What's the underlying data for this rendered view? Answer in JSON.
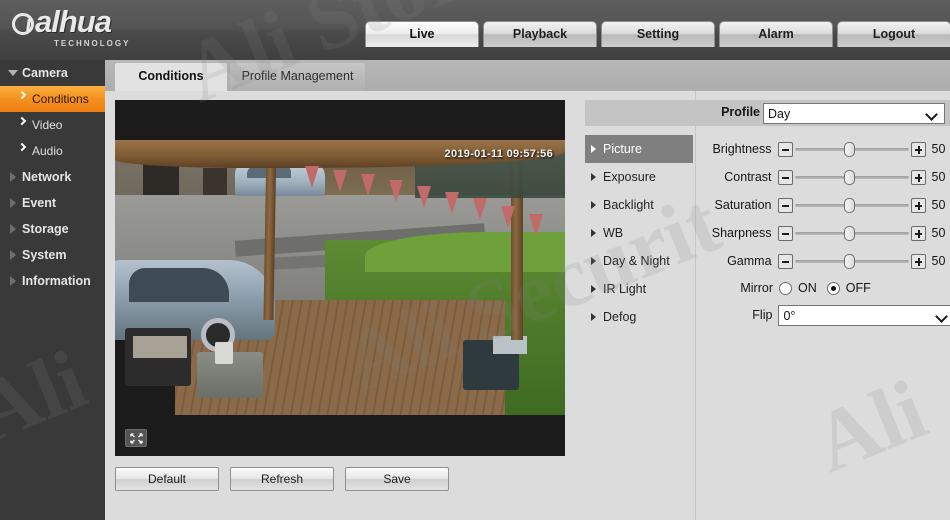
{
  "brand": {
    "name": "alhua",
    "tagline": "TECHNOLOGY"
  },
  "watermark": {
    "line1": "Ali Store",
    "line2": "Ali Securit",
    "line3": "Ali",
    "line4": "Ali"
  },
  "nav": {
    "tabs": [
      {
        "label": "Live",
        "active": true
      },
      {
        "label": "Playback",
        "active": false
      },
      {
        "label": "Setting",
        "active": false
      },
      {
        "label": "Alarm",
        "active": false
      },
      {
        "label": "Logout",
        "active": false
      }
    ]
  },
  "sidebar": {
    "items": [
      {
        "label": "Camera",
        "level": "top",
        "expanded": true,
        "active": false
      },
      {
        "label": "Conditions",
        "level": "sub",
        "active": true
      },
      {
        "label": "Video",
        "level": "sub",
        "active": false
      },
      {
        "label": "Audio",
        "level": "sub",
        "active": false
      },
      {
        "label": "Network",
        "level": "top",
        "expanded": false,
        "active": false
      },
      {
        "label": "Event",
        "level": "top",
        "expanded": false,
        "active": false
      },
      {
        "label": "Storage",
        "level": "top",
        "expanded": false,
        "active": false
      },
      {
        "label": "System",
        "level": "top",
        "expanded": false,
        "active": false
      },
      {
        "label": "Information",
        "level": "top",
        "expanded": false,
        "active": false
      }
    ]
  },
  "content_tabs": [
    {
      "label": "Conditions",
      "active": true
    },
    {
      "label": "Profile Management",
      "active": false
    }
  ],
  "video": {
    "timestamp": "2019-01-11 09:57:56",
    "expand_icon": "fullscreen-icon"
  },
  "action_buttons": [
    {
      "label": "Default"
    },
    {
      "label": "Refresh"
    },
    {
      "label": "Save"
    }
  ],
  "profile": {
    "label": "Profile",
    "value": "Day"
  },
  "submenu": [
    {
      "label": "Picture",
      "active": true
    },
    {
      "label": "Exposure",
      "active": false
    },
    {
      "label": "Backlight",
      "active": false
    },
    {
      "label": "WB",
      "active": false
    },
    {
      "label": "Day & Night",
      "active": false
    },
    {
      "label": "IR Light",
      "active": false
    },
    {
      "label": "Defog",
      "active": false
    }
  ],
  "sliders": [
    {
      "label": "Brightness",
      "value": "50",
      "percent": 50
    },
    {
      "label": "Contrast",
      "value": "50",
      "percent": 50
    },
    {
      "label": "Saturation",
      "value": "50",
      "percent": 50
    },
    {
      "label": "Sharpness",
      "value": "50",
      "percent": 50
    },
    {
      "label": "Gamma",
      "value": "50",
      "percent": 50
    }
  ],
  "mirror": {
    "label": "Mirror",
    "on_label": "ON",
    "off_label": "OFF",
    "selected": "OFF"
  },
  "flip": {
    "label": "Flip",
    "value": "0°"
  },
  "colors": {
    "accent": "#f59120",
    "sidebar_bg": "#393939",
    "header_bg": "#4a4a4a",
    "page_bg": "#dcdcdc",
    "submenu_active": "#7f7f7f"
  }
}
